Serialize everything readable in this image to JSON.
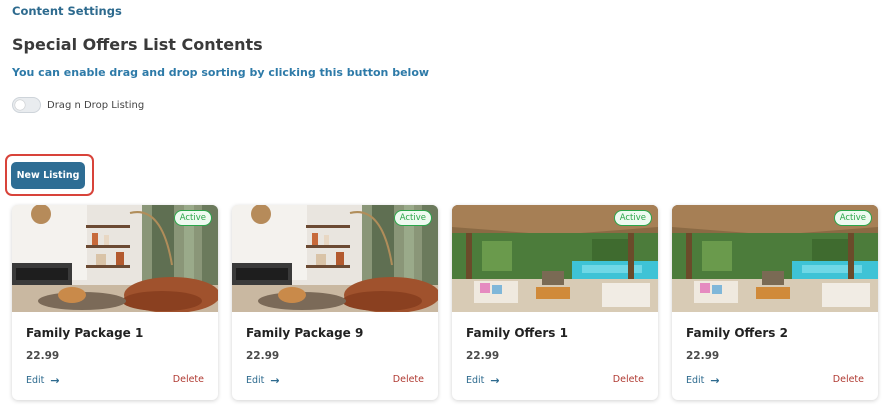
{
  "header": {
    "breadcrumb": "Content Settings",
    "title": "Special Offers List Contents",
    "hint": "You can enable drag and drop sorting by clicking this button below"
  },
  "toggle": {
    "label": "Drag n Drop Listing",
    "enabled": false
  },
  "new_listing_button": {
    "label": "New Listing",
    "highlighted": true,
    "highlight_color": "#d8433a"
  },
  "colors": {
    "primary": "#2e6d94",
    "link": "#2d6a8e",
    "delete": "#b03a32",
    "active": "#2aa64a"
  },
  "listings": [
    {
      "title": "Family Package 1",
      "price": "22.99",
      "status": "Active",
      "edit_label": "Edit",
      "delete_label": "Delete",
      "image": "living-room-interior"
    },
    {
      "title": "Family Package 9",
      "price": "22.99",
      "status": "Active",
      "edit_label": "Edit",
      "delete_label": "Delete",
      "image": "living-room-interior"
    },
    {
      "title": "Family Offers 1",
      "price": "22.99",
      "status": "Active",
      "edit_label": "Edit",
      "delete_label": "Delete",
      "image": "pool-cabana"
    },
    {
      "title": "Family Offers 2",
      "price": "22.99",
      "status": "Active",
      "edit_label": "Edit",
      "delete_label": "Delete",
      "image": "pool-cabana"
    }
  ]
}
